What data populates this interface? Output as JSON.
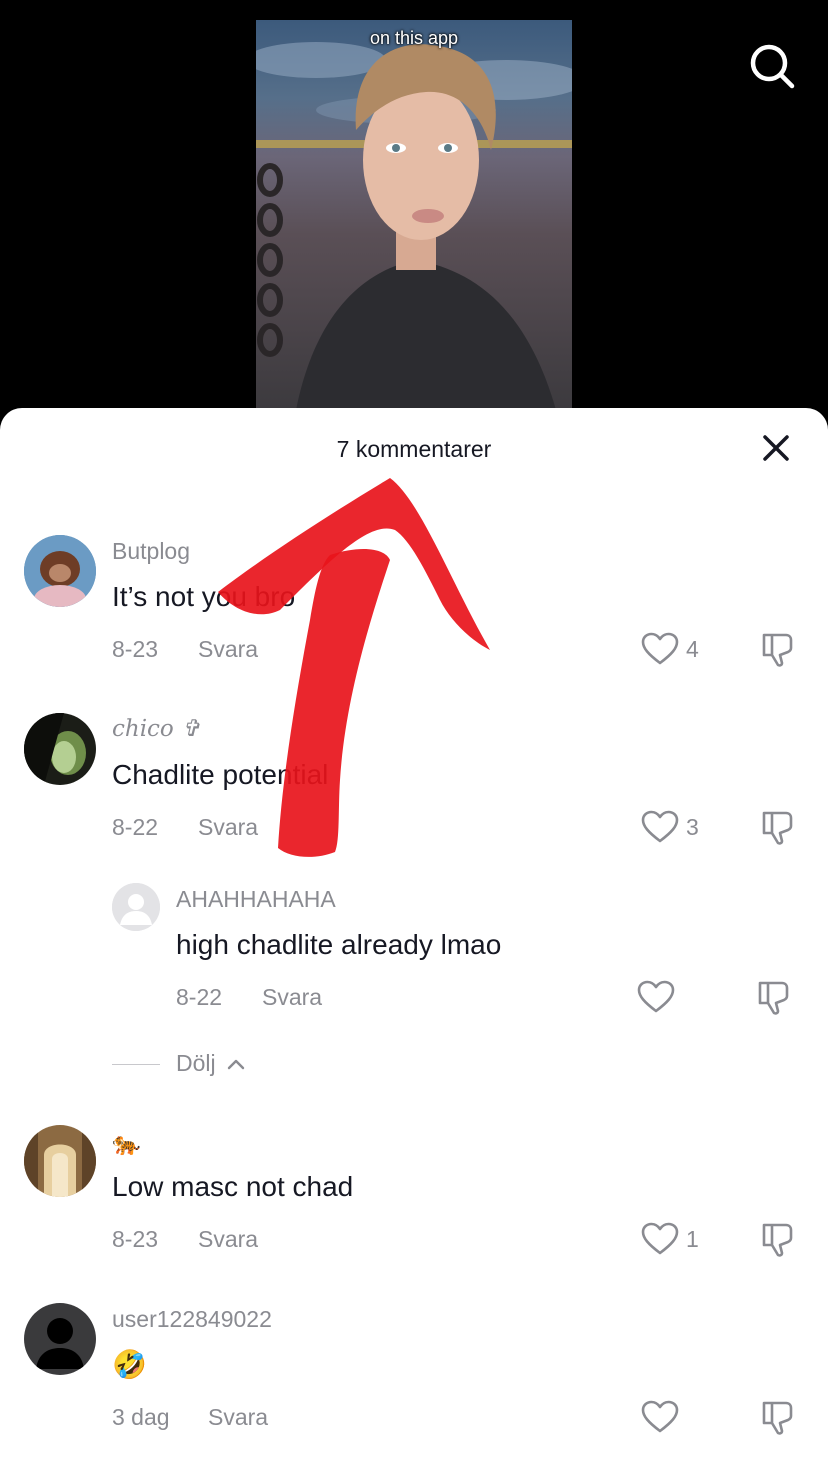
{
  "video": {
    "caption": "on this app"
  },
  "comments_sheet": {
    "title": "7 kommentarer",
    "reply_label": "Svara",
    "comments": [
      {
        "username": "Butplog",
        "text": "It’s not you bro",
        "date": "8-23",
        "likes": "4"
      },
      {
        "username": "chico ✞",
        "text": "Chadlite potential",
        "date": "8-22",
        "likes": "3"
      },
      {
        "username": "AHAHHAHAHA",
        "text": "high chadlite already lmao",
        "date": "8-22",
        "likes": ""
      },
      {
        "username": "🐅",
        "text": "Low masc not chad",
        "date": "8-23",
        "likes": "1"
      },
      {
        "username": "user122849022",
        "text": "🤣",
        "date": "3 dag",
        "likes": ""
      }
    ],
    "hide_replies_label": "Dölj"
  },
  "colors": {
    "accent_annotation": "#e8141b",
    "secondary_text": "#8a8b91",
    "primary_text": "#161823"
  },
  "icons": [
    "search-icon",
    "close-icon",
    "heart-icon",
    "dislike-icon",
    "chevron-up-icon"
  ]
}
